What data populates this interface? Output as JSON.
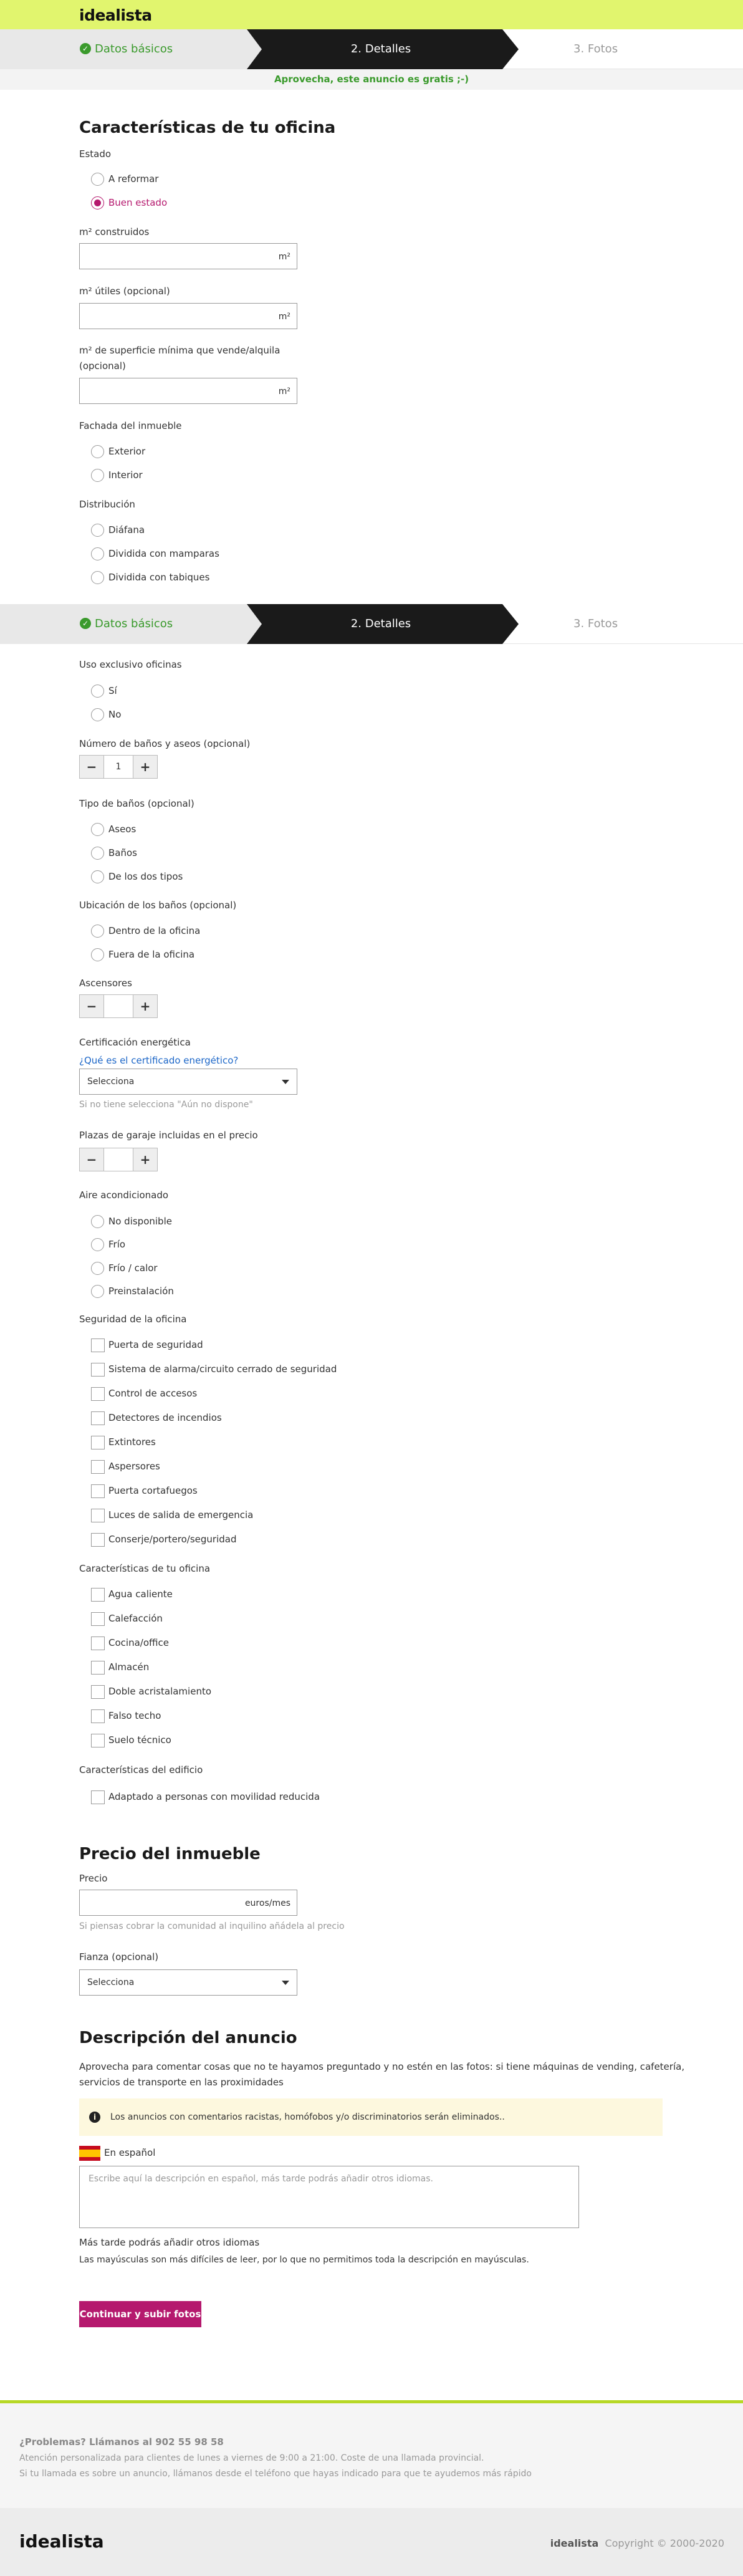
{
  "brand": {
    "logo": "idealista"
  },
  "steps": {
    "step1": "Datos básicos",
    "step2": "2. Detalles",
    "step3": "3. Fotos"
  },
  "promo": "Aprovecha, este anuncio es gratis ;-)",
  "section_features": {
    "title": "Características de tu oficina",
    "estado": {
      "label": "Estado",
      "options": [
        "A reformar",
        "Buen estado"
      ],
      "selected": "Buen estado"
    },
    "m2_construidos": {
      "label": "m² construidos",
      "unit": "m²"
    },
    "m2_utiles": {
      "label": "m² útiles (opcional)",
      "unit": "m²"
    },
    "m2_minima": {
      "label_line1": "m² de superficie mínima que vende/alquila",
      "label_line2": "(opcional)",
      "unit": "m²"
    },
    "fachada": {
      "label": "Fachada del inmueble",
      "options": [
        "Exterior",
        "Interior"
      ]
    },
    "distribucion": {
      "label": "Distribución",
      "options": [
        "Diáfana",
        "Dividida con mamparas",
        "Dividida con tabiques"
      ]
    },
    "uso_exclusivo": {
      "label": "Uso exclusivo oficinas",
      "options": [
        "Sí",
        "No"
      ]
    },
    "banos": {
      "label": "Número de baños y aseos (opcional)",
      "value": "1",
      "minus": "−",
      "plus": "+"
    },
    "tipo_banos": {
      "label": "Tipo de baños (opcional)",
      "options": [
        "Aseos",
        "Baños",
        "De los dos tipos"
      ]
    },
    "ubicacion_banos": {
      "label": "Ubicación de los baños (opcional)",
      "options": [
        "Dentro de la oficina",
        "Fuera de la oficina"
      ]
    },
    "ascensores": {
      "label": "Ascensores",
      "value": "",
      "minus": "−",
      "plus": "+"
    },
    "certificacion": {
      "label": "Certificación energética",
      "link": "¿Qué es el certificado energético?",
      "selected": "Selecciona",
      "hint": "Si no tiene selecciona \"Aún no dispone\""
    },
    "plazas": {
      "label": "Plazas de garaje incluidas en el precio",
      "value": "",
      "minus": "−",
      "plus": "+"
    },
    "aire": {
      "label": "Aire acondicionado",
      "options": [
        "No disponible",
        "Frío",
        "Frío / calor",
        "Preinstalación"
      ]
    },
    "seguridad": {
      "label": "Seguridad de la oficina",
      "options": [
        "Puerta de seguridad",
        "Sistema de alarma/circuito cerrado de seguridad",
        "Control de accesos",
        "Detectores de incendios",
        "Extintores",
        "Aspersores",
        "Puerta cortafuegos",
        "Luces de salida de emergencia",
        "Conserje/portero/seguridad"
      ]
    },
    "caracteristicas": {
      "label": "Características de tu oficina",
      "options": [
        "Agua caliente",
        "Calefacción",
        "Cocina/office",
        "Almacén",
        "Doble acristalamiento",
        "Falso techo",
        "Suelo técnico"
      ]
    },
    "edificio": {
      "label": "Características del edificio",
      "options": [
        "Adaptado a personas con movilidad reducida"
      ]
    }
  },
  "section_price": {
    "title": "Precio del inmueble",
    "precio": {
      "label": "Precio",
      "unit": "euros/mes",
      "hint": "Si piensas cobrar la comunidad al inquilino añádela al precio"
    },
    "fianza": {
      "label": "Fianza (opcional)",
      "selected": "Selecciona"
    }
  },
  "section_desc": {
    "title": "Descripción del anuncio",
    "intro_line1": "Aprovecha para comentar cosas que no te hayamos preguntado y no estén en las fotos: si tiene máquinas de vending, cafetería,",
    "intro_line2": "servicios de transporte en las proximidades",
    "notice": "Los anuncios con comentarios racistas, homófobos y/o discriminatorios serán eliminados..",
    "lang": "En español",
    "placeholder": "Escribe aquí la descripción en español, más tarde podrás añadir otros idiomas.",
    "later": "Más tarde podrás añadir otros idiomas",
    "caps": "Las mayúsculas son más difíciles de leer, por lo que no permitimos toda la descripción en mayúsculas.",
    "button": "Continuar y subir fotos"
  },
  "footer": {
    "phone": "¿Problemas? Llámanos al 902 55 98 58",
    "line1": "Atención personalizada para clientes de lunes a viernes de 9:00 a 21:00. Coste de una llamada provincial.",
    "line2": "Si tu llamada es sobre un anuncio, llámanos desde el teléfono que hayas indicado para que te ayudemos más rápido",
    "brand": "idealista",
    "copyright": "Copyright © 2000-2020"
  },
  "colors": {
    "accent": "#b5196e",
    "brand": "#e1f56e",
    "success": "#3a9a2c"
  }
}
